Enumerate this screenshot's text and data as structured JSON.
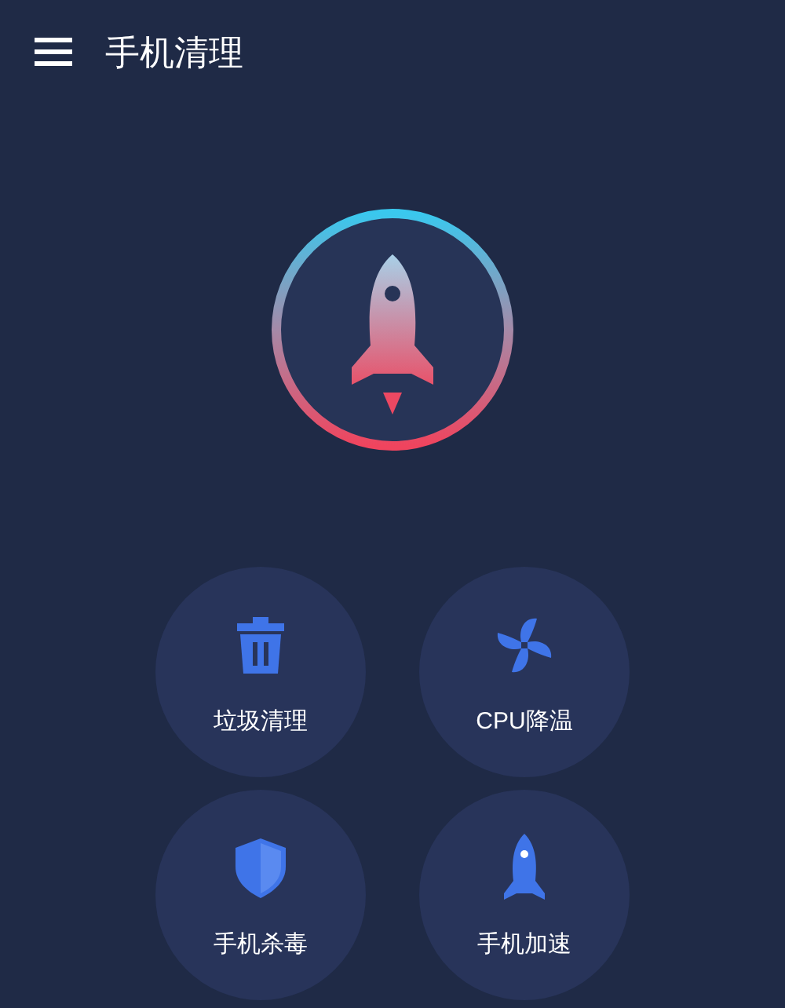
{
  "header": {
    "title": "手机清理"
  },
  "features": [
    {
      "kind": "trash",
      "label": "垃圾清理"
    },
    {
      "kind": "fan",
      "label": "CPU降温"
    },
    {
      "kind": "shield",
      "label": "手机杀毒"
    },
    {
      "kind": "rocket",
      "label": "手机加速"
    }
  ]
}
